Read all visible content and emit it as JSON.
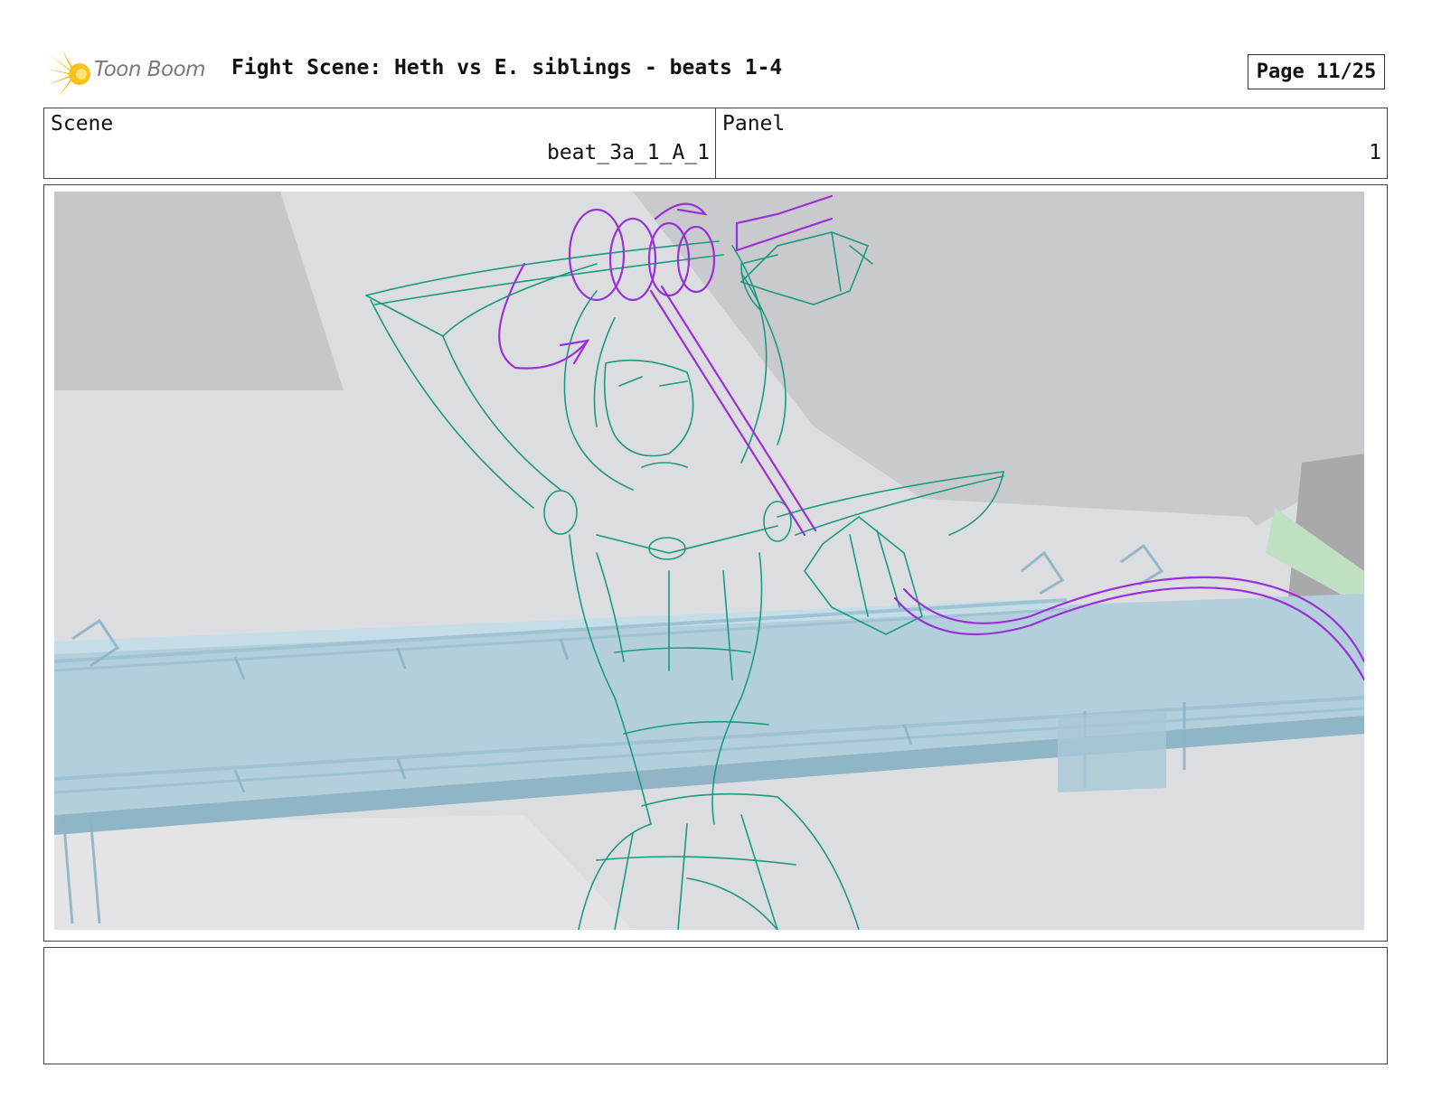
{
  "header": {
    "logo_text": "Toon Boom",
    "title": "Fight Scene: Heth vs E. siblings - beats 1-4",
    "page": "Page 11/25"
  },
  "info": {
    "scene_label": "Scene",
    "scene_value": "beat_3a_1_A_1",
    "panel_label": "Panel",
    "panel_value": "1"
  },
  "colors": {
    "sketch_line": "#1a9a7e",
    "action_line": "#9b2fd8",
    "railing": "#a9cad8",
    "background": "#dcdde0"
  },
  "notes": {
    "text": ""
  }
}
